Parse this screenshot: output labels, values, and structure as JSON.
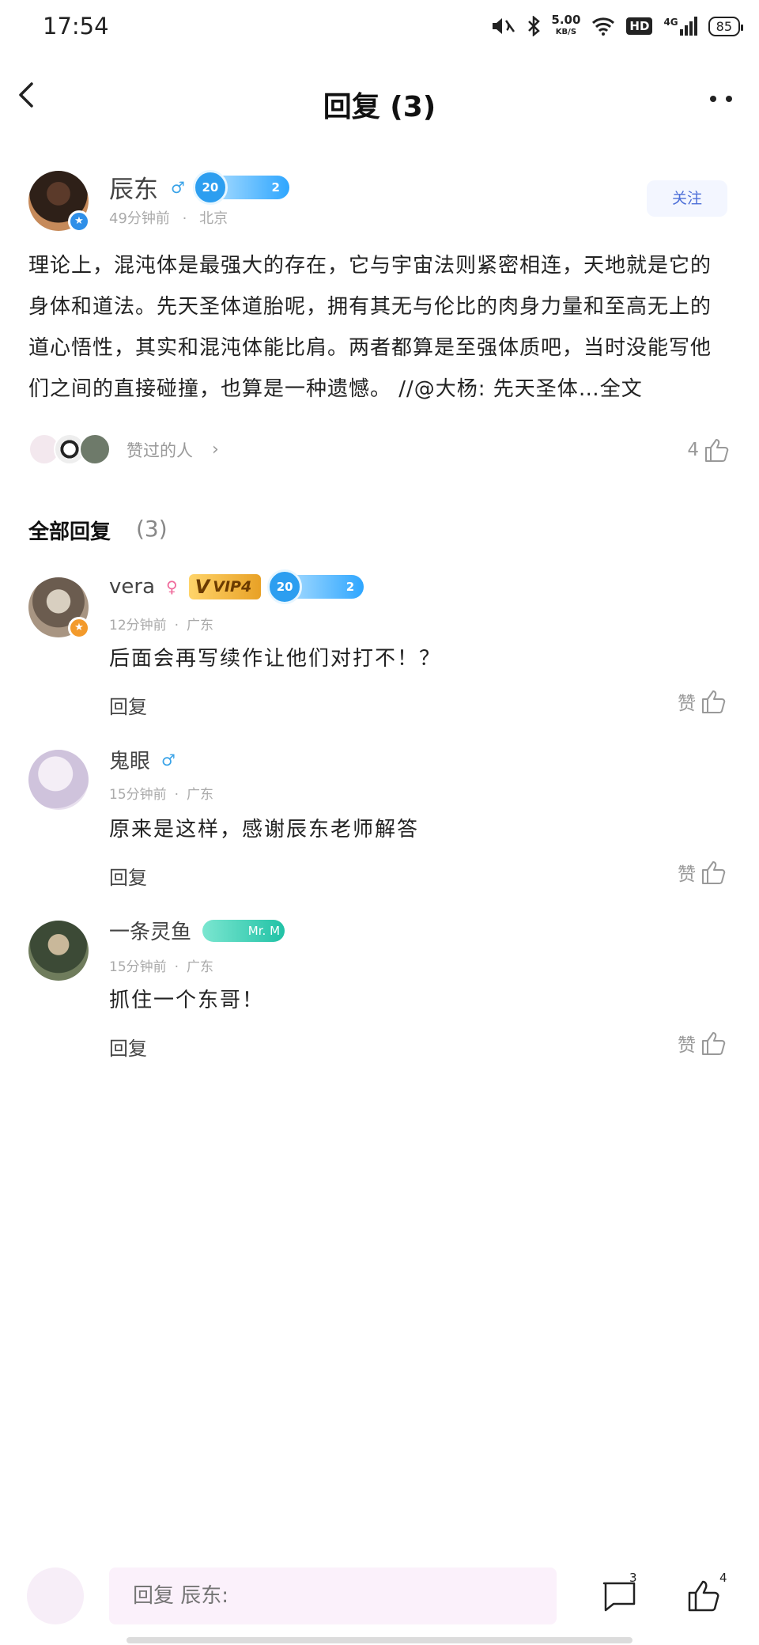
{
  "status_bar": {
    "time": "17:54",
    "net_speed": "5.00",
    "net_speed_unit": "KB/S",
    "hd": "HD",
    "signal": "4G",
    "battery": "85",
    "icons": [
      "mute-icon",
      "bluetooth-icon",
      "wifi-icon",
      "signal-icon"
    ]
  },
  "header": {
    "title": "回复 (3)"
  },
  "post": {
    "author": "辰东",
    "level_text": "20",
    "level_suffix": "2",
    "time": "49分钟前",
    "location": "北京",
    "follow_label": "关注",
    "text": "理论上，混沌体是最强大的存在，它与宇宙法则紧密相连，天地就是它的身体和道法。先天圣体道胎呢，拥有其无与伦比的肉身力量和至高无上的道心悟性，其实和混沌体能比肩。两者都算是至强体质吧，当时没能写他们之间的直接碰撞，也算是一种遗憾。 //@大杨: 先天圣体…全文",
    "likers_label": "赞过的人",
    "like_count": "4"
  },
  "replies_section": {
    "title": "全部回复",
    "count": "(3)"
  },
  "replies": [
    {
      "name": "vera",
      "gender": "female",
      "vip": "VIP4",
      "level_text": "20",
      "level_suffix": "2",
      "time": "12分钟前",
      "location": "广东",
      "text": "后面会再写续作让他们对打不！？",
      "reply_label": "回复",
      "like_label": "赞"
    },
    {
      "name": "鬼眼",
      "gender": "male",
      "time": "15分钟前",
      "location": "广东",
      "text": "原来是这样，感谢辰东老师解答",
      "reply_label": "回复",
      "like_label": "赞"
    },
    {
      "name": "一条灵鱼",
      "badge": "Mr. M",
      "time": "15分钟前",
      "location": "广东",
      "text": "抓住一个东哥！",
      "reply_label": "回复",
      "like_label": "赞"
    }
  ],
  "bottom_bar": {
    "input_placeholder": "回复 辰东:",
    "comment_count": "3",
    "like_count": "4"
  },
  "colors": {
    "accent": "#4d6fd8",
    "level_blue": "#2ea6ff",
    "vip_gold": "#e8a126",
    "teal": "#21c2a6"
  }
}
